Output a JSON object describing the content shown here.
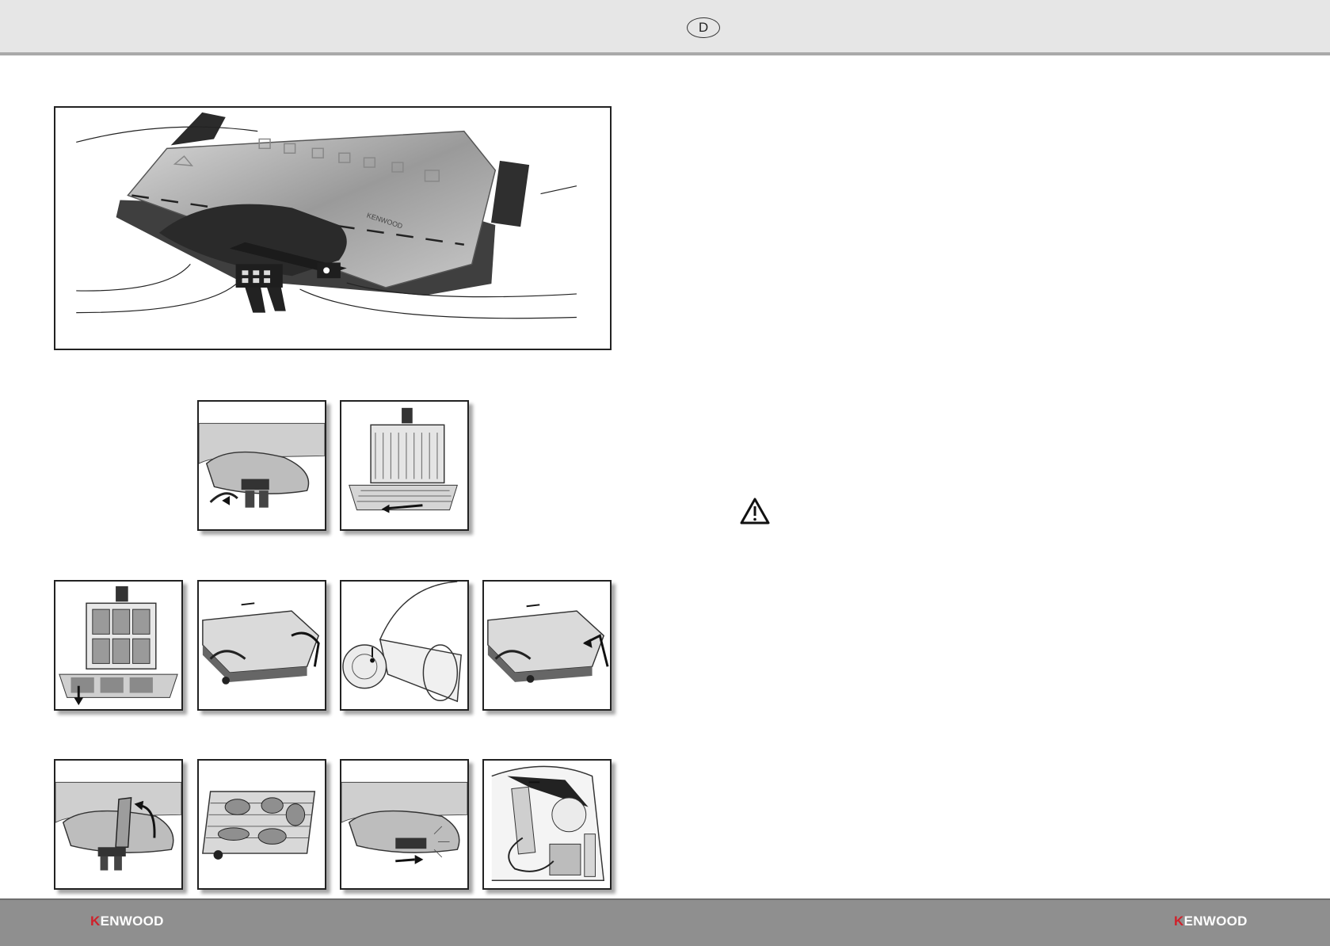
{
  "header": {
    "language_badge": "D"
  },
  "main_figure": {
    "brand_on_lid": "KENWOOD"
  },
  "footer": {
    "logo_left": {
      "k": "K",
      "rest": "ENWOOD"
    },
    "logo_right": {
      "k": "K",
      "rest": "ENWOOD"
    }
  },
  "icons": {
    "warning": "warning-triangle-icon"
  },
  "colors": {
    "header_bg": "#e6e6e6",
    "footer_bg": "#8f8f8f",
    "brand_red": "#d0202a"
  }
}
